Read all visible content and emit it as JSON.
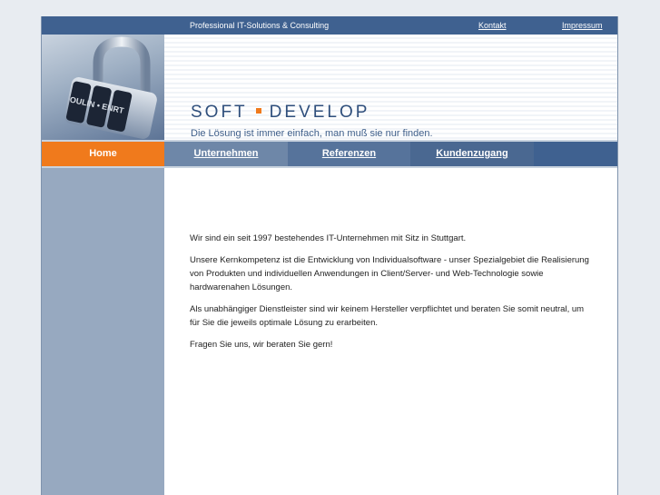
{
  "topbar": {
    "tagline": "Professional IT-Solutions & Consulting",
    "links": [
      "Kontakt",
      "Impressum"
    ]
  },
  "header": {
    "logo_left": "SOFT",
    "logo_right": "DEVELOP",
    "slogan": "Die Lösung ist immer einfach, man muß sie nur finden.",
    "lock_letters": "OULIN • ENRT"
  },
  "nav": {
    "items": [
      "Home",
      "Unternehmen",
      "Referenzen",
      "Kundenzugang"
    ],
    "active": "Home"
  },
  "content": {
    "paragraphs": [
      "Wir sind ein seit 1997 bestehendes IT-Unternehmen mit Sitz in Stuttgart.",
      "Unsere Kernkompetenz ist die Entwicklung von Individualsoftware - unser Spezialgebiet die Realisierung von Produkten und individuellen Anwendungen in Client/Server- und Web-Technologie sowie hardwarenahen Lösungen.",
      "Als unabhängiger Dienstleister sind wir keinem Hersteller verpflichtet und beraten Sie somit neutral, um für Sie die jeweils optimale Lösung zu erarbeiten.",
      "Fragen Sie uns, wir beraten Sie gern!"
    ]
  },
  "colors": {
    "accent_orange": "#f07a1c",
    "nav_blue": "#3f6190",
    "sidebar": "#97a9c0"
  }
}
